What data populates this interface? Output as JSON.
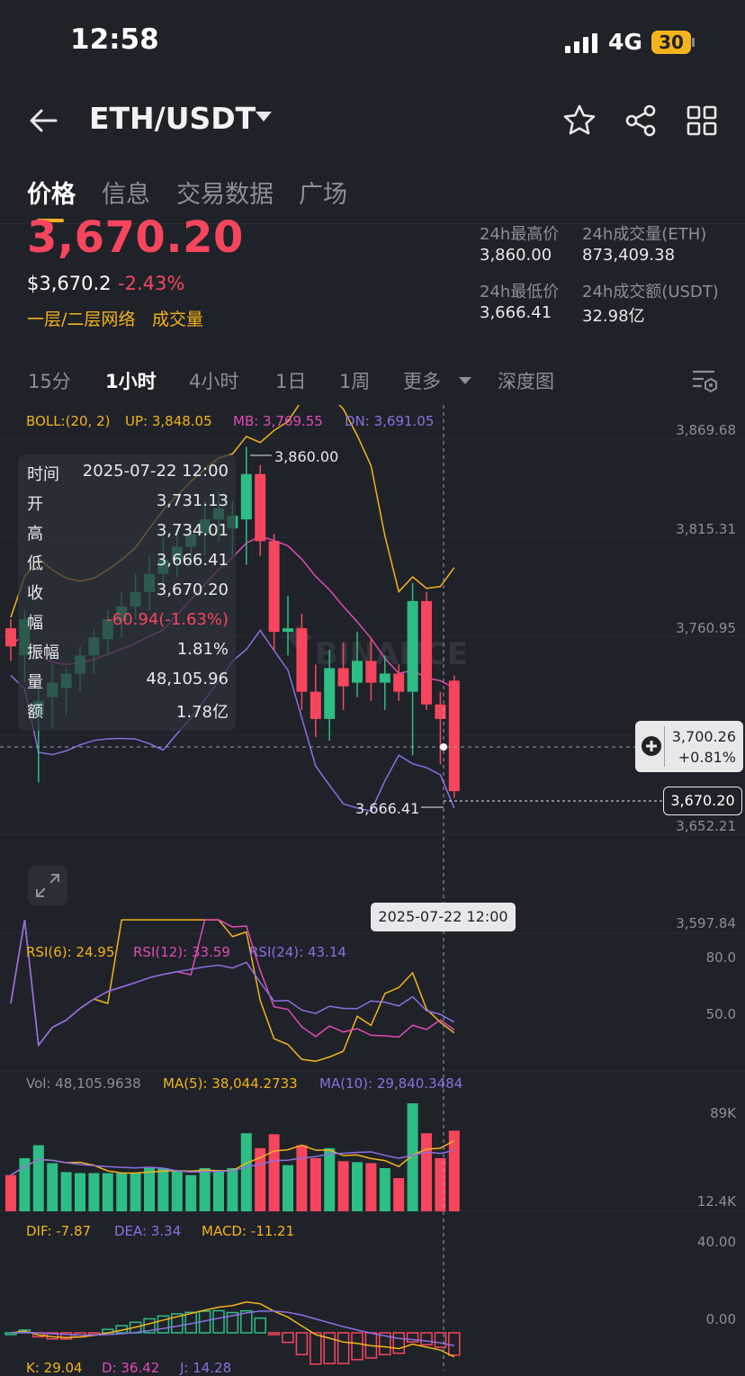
{
  "status": {
    "time": "12:58",
    "network": "4G",
    "battery": "30"
  },
  "header": {
    "title": "ETH/USDT"
  },
  "tabs": [
    "价格",
    "信息",
    "交易数据",
    "广场"
  ],
  "price": {
    "last": "3,670.20",
    "usd": "$3,670.2",
    "change_pct": "-2.43%",
    "tag1": "一层/二层网络",
    "tag2": "成交量"
  },
  "stats": {
    "high_label": "24h最高价",
    "high": "3,860.00",
    "low_label": "24h最低价",
    "low": "3,666.41",
    "vol_label": "24h成交量(ETH)",
    "vol": "873,409.38",
    "amt_label": "24h成交额(USDT)",
    "amt": "32.98亿"
  },
  "timeframes": [
    "15分",
    "1小时",
    "4小时",
    "1日",
    "1周",
    "更多",
    "深度图"
  ],
  "boll": {
    "label": "BOLL:(20, 2)",
    "up": "UP: 3,848.05",
    "mb": "MB: 3,769.55",
    "dn": "DN: 3,691.05"
  },
  "price_axis": [
    "3,869.68",
    "3,815.31",
    "3,760.95",
    "3,652.21",
    "3,597.84"
  ],
  "high_mark": "3,860.00",
  "low_mark": "3,666.41",
  "tooltip": [
    {
      "k": "时间",
      "v": "2025-07-22 12:00"
    },
    {
      "k": "开",
      "v": "3,731.13"
    },
    {
      "k": "高",
      "v": "3,734.01"
    },
    {
      "k": "低",
      "v": "3,666.41"
    },
    {
      "k": "收",
      "v": "3,670.20"
    },
    {
      "k": "幅",
      "v": "-60.94(-1.63%)"
    },
    {
      "k": "振幅",
      "v": "1.81%"
    },
    {
      "k": "量",
      "v": "48,105.96"
    },
    {
      "k": "额",
      "v": "1.78亿"
    }
  ],
  "crosshair": {
    "price": "3,700.26",
    "pct": "+0.81%",
    "time": "2025-07-22 12:00"
  },
  "last_box": "3,670.20",
  "rsi": {
    "r6": "RSI(6): 24.95",
    "r12": "RSI(12): 33.59",
    "r24": "RSI(24): 43.14",
    "axis_hi": "80.0",
    "axis_mid": "50.0"
  },
  "vol": {
    "vol": "Vol: 48,105.9638",
    "ma5": "MA(5): 38,044.2733",
    "ma10": "MA(10): 29,840.3484",
    "axis_hi": "89K",
    "axis_lo": "12.4K"
  },
  "macd": {
    "dif": "DIF: -7.87",
    "dea": "DEA: 3.34",
    "macd": "MACD: -11.21",
    "axis_hi": "40.00",
    "axis_zero": "0.00"
  },
  "kdj": {
    "k": "K: 29.04",
    "d": "D: 36.42",
    "j": "J: 14.28"
  },
  "colors": {
    "up": "#2ebd85",
    "down": "#f6465d",
    "accent": "#f3b31d",
    "boll_mb": "#e04bb5",
    "boll_dn": "#8c6fe0"
  },
  "chart_data": {
    "type": "candlestick",
    "candles": [
      {
        "o": 3760,
        "h": 3765,
        "l": 3742,
        "c": 3750
      },
      {
        "o": 3745,
        "h": 3770,
        "l": 3730,
        "c": 3765
      },
      {
        "o": 3712,
        "h": 3728,
        "l": 3675,
        "c": 3720
      },
      {
        "o": 3722,
        "h": 3740,
        "l": 3705,
        "c": 3730
      },
      {
        "o": 3727,
        "h": 3738,
        "l": 3712,
        "c": 3735
      },
      {
        "o": 3735,
        "h": 3750,
        "l": 3725,
        "c": 3745
      },
      {
        "o": 3745,
        "h": 3760,
        "l": 3735,
        "c": 3755
      },
      {
        "o": 3754,
        "h": 3770,
        "l": 3745,
        "c": 3765
      },
      {
        "o": 3764,
        "h": 3780,
        "l": 3755,
        "c": 3772
      },
      {
        "o": 3772,
        "h": 3790,
        "l": 3765,
        "c": 3780
      },
      {
        "o": 3780,
        "h": 3800,
        "l": 3770,
        "c": 3790
      },
      {
        "o": 3790,
        "h": 3810,
        "l": 3780,
        "c": 3798
      },
      {
        "o": 3798,
        "h": 3815,
        "l": 3788,
        "c": 3805
      },
      {
        "o": 3805,
        "h": 3818,
        "l": 3795,
        "c": 3812
      },
      {
        "o": 3812,
        "h": 3830,
        "l": 3800,
        "c": 3820
      },
      {
        "o": 3820,
        "h": 3835,
        "l": 3808,
        "c": 3826
      },
      {
        "o": 3815,
        "h": 3830,
        "l": 3800,
        "c": 3822
      },
      {
        "o": 3820,
        "h": 3860,
        "l": 3795,
        "c": 3845
      },
      {
        "o": 3845,
        "h": 3850,
        "l": 3800,
        "c": 3808
      },
      {
        "o": 3808,
        "h": 3812,
        "l": 3748,
        "c": 3758
      },
      {
        "o": 3758,
        "h": 3778,
        "l": 3745,
        "c": 3760
      },
      {
        "o": 3760,
        "h": 3768,
        "l": 3715,
        "c": 3725
      },
      {
        "o": 3725,
        "h": 3740,
        "l": 3700,
        "c": 3710
      },
      {
        "o": 3710,
        "h": 3748,
        "l": 3698,
        "c": 3738
      },
      {
        "o": 3738,
        "h": 3752,
        "l": 3715,
        "c": 3728
      },
      {
        "o": 3730,
        "h": 3758,
        "l": 3722,
        "c": 3742
      },
      {
        "o": 3742,
        "h": 3755,
        "l": 3720,
        "c": 3730
      },
      {
        "o": 3730,
        "h": 3745,
        "l": 3715,
        "c": 3735
      },
      {
        "o": 3735,
        "h": 3740,
        "l": 3720,
        "c": 3725
      },
      {
        "o": 3725,
        "h": 3785,
        "l": 3690,
        "c": 3775
      },
      {
        "o": 3775,
        "h": 3780,
        "l": 3715,
        "c": 3718
      },
      {
        "o": 3718,
        "h": 3725,
        "l": 3685,
        "c": 3710
      },
      {
        "o": 3731.13,
        "h": 3734.01,
        "l": 3666.41,
        "c": 3670.2
      }
    ],
    "y_range": [
      3597.84,
      3869.68
    ]
  }
}
